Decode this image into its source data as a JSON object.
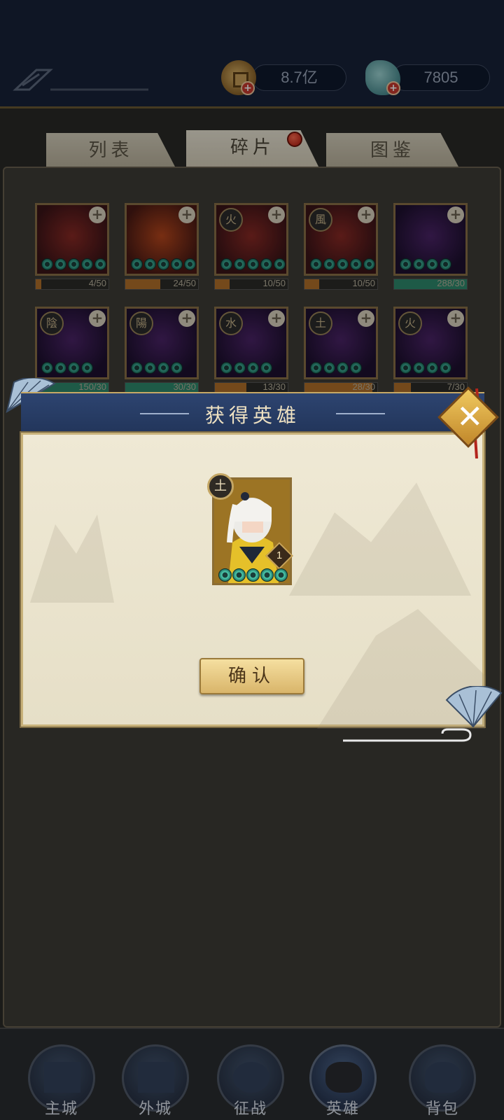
{
  "header": {
    "coins": "8.7亿",
    "jade": "7805",
    "plus_label": "+"
  },
  "tabs": {
    "list": "列表",
    "fragments": "碎片",
    "atlas": "图鉴"
  },
  "fragments": [
    {
      "element": "",
      "progress": "4/50",
      "fill": 0.08,
      "fill_color": "#b3712a",
      "theme": "red"
    },
    {
      "element": "",
      "progress": "24/50",
      "fill": 0.48,
      "fill_color": "#b3712a",
      "theme": "fire"
    },
    {
      "element": "火",
      "progress": "10/50",
      "fill": 0.2,
      "fill_color": "#b3712a",
      "theme": "red"
    },
    {
      "element": "風",
      "progress": "10/50",
      "fill": 0.2,
      "fill_color": "#b3712a",
      "theme": "red"
    },
    {
      "element": "",
      "progress": "288/30",
      "fill": 1.0,
      "fill_color": "#2e8a6e",
      "theme": "purple"
    },
    {
      "element": "陰",
      "progress": "150/30",
      "fill": 1.0,
      "fill_color": "#2e8a6e",
      "theme": "purple"
    },
    {
      "element": "陽",
      "progress": "30/30",
      "fill": 1.0,
      "fill_color": "#2e8a6e",
      "theme": "purple"
    },
    {
      "element": "水",
      "progress": "13/30",
      "fill": 0.43,
      "fill_color": "#b3712a",
      "theme": "purple"
    },
    {
      "element": "土",
      "progress": "28/30",
      "fill": 0.93,
      "fill_color": "#b3712a",
      "theme": "purple"
    },
    {
      "element": "火",
      "progress": "7/30",
      "fill": 0.23,
      "fill_color": "#b3712a",
      "theme": "purple"
    }
  ],
  "dialog": {
    "title": "获得英雄",
    "close_label": "✕",
    "hero": {
      "element": "土",
      "level": "1",
      "stars": 5
    },
    "confirm_label": "确认"
  },
  "nav": {
    "main_city": "主城",
    "outer_city": "外城",
    "campaign": "征战",
    "heroes": "英雄",
    "bag": "背包"
  }
}
